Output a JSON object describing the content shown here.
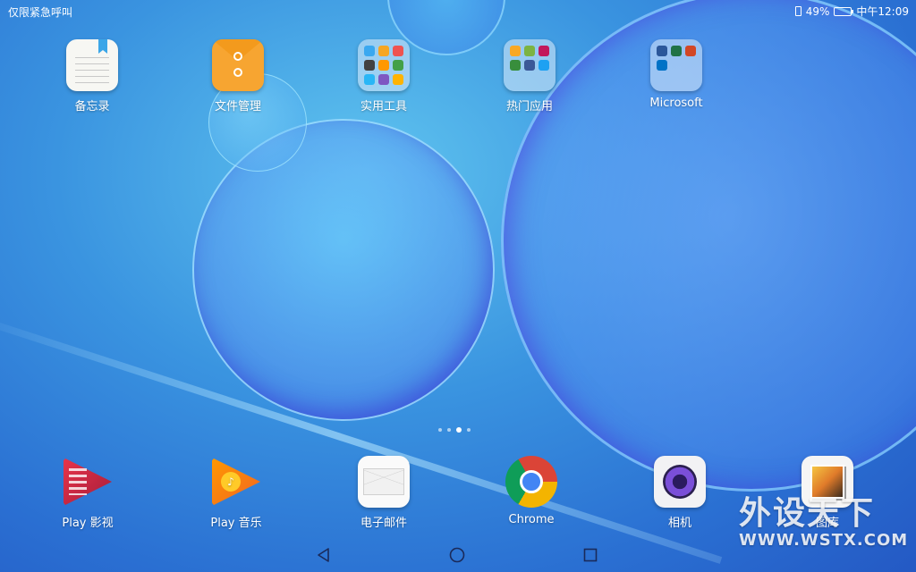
{
  "status_bar": {
    "carrier_text": "仅限紧急呼叫",
    "battery_percent": "49%",
    "battery_level": 0.49,
    "time": "中午12:09"
  },
  "home_apps": [
    {
      "label": "备忘录",
      "icon": "memo-icon"
    },
    {
      "label": "文件管理",
      "icon": "files-icon"
    },
    {
      "label": "实用工具",
      "icon": "tools-folder-icon"
    },
    {
      "label": "热门应用",
      "icon": "popular-folder-icon"
    },
    {
      "label": "Microsoft",
      "icon": "microsoft-folder-icon"
    }
  ],
  "dock_apps": [
    {
      "label": "Play 影视",
      "icon": "play-movies-icon"
    },
    {
      "label": "Play 音乐",
      "icon": "play-music-icon"
    },
    {
      "label": "电子邮件",
      "icon": "email-icon"
    },
    {
      "label": "Chrome",
      "icon": "chrome-icon"
    },
    {
      "label": "相机",
      "icon": "camera-icon"
    },
    {
      "label": "图库",
      "icon": "gallery-icon"
    }
  ],
  "page_indicator": {
    "count": 4,
    "active": 3
  },
  "navigation": {
    "back": "back-icon",
    "home": "home-icon",
    "recent": "recent-apps-icon"
  },
  "watermark": {
    "title": "外设天下",
    "url": "WWW.WSTX.COM"
  },
  "colors": {
    "wallpaper_primary": "#3a94e0",
    "wallpaper_dark": "#2459c4",
    "text": "#ffffff"
  }
}
